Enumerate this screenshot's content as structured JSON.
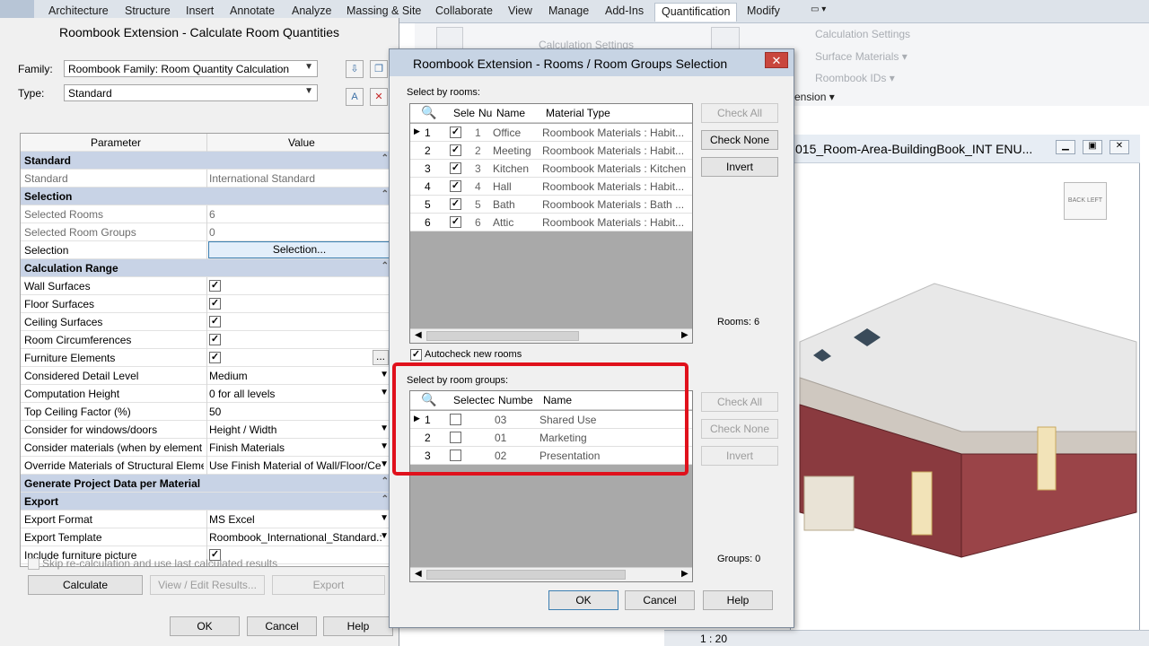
{
  "ribbon": {
    "tabs": [
      "Architecture",
      "Structure",
      "Insert",
      "Annotate",
      "Analyze",
      "Massing & Site",
      "Collaborate",
      "View",
      "Manage",
      "Add-Ins",
      "Quantification",
      "Modify"
    ],
    "active_tab": "Quantification",
    "panel_items": [
      "Calculation Settings",
      "Surface Materials ▾",
      "Roombook IDs ▾"
    ],
    "panel_left_item": "Calculation Settings",
    "panel_label": "ension ▾"
  },
  "viewport": {
    "title": "015_Room-Area-BuildingBook_INT ENU...",
    "viewcube_faces": [
      "BACK",
      "LEFT"
    ],
    "scale": "1 : 20"
  },
  "left_dialog": {
    "title": "Roombook Extension - Calculate Room Quantities",
    "family_label": "Family:",
    "family_value": "Roombook Family: Room Quantity Calculation",
    "type_label": "Type:",
    "type_value": "Standard",
    "grid_headers": [
      "Parameter",
      "Value"
    ],
    "rows": [
      {
        "kind": "cat",
        "label": "Standard"
      },
      {
        "kind": "text",
        "label": "Standard",
        "value": "International Standard",
        "dim": true
      },
      {
        "kind": "cat",
        "label": "Selection"
      },
      {
        "kind": "text",
        "label": "Selected Rooms",
        "value": "6",
        "dim": true
      },
      {
        "kind": "text",
        "label": "Selected Room Groups",
        "value": "0",
        "dim": true
      },
      {
        "kind": "button",
        "label": "Selection",
        "value": "Selection..."
      },
      {
        "kind": "cat",
        "label": "Calculation Range"
      },
      {
        "kind": "check",
        "label": "Wall Surfaces",
        "checked": true
      },
      {
        "kind": "check",
        "label": "Floor Surfaces",
        "checked": true
      },
      {
        "kind": "check",
        "label": "Ceiling Surfaces",
        "checked": true
      },
      {
        "kind": "check",
        "label": "Room Circumferences",
        "checked": true
      },
      {
        "kind": "check",
        "label": "Furniture Elements",
        "checked": true,
        "ellipsis": "..."
      },
      {
        "kind": "dropdown",
        "label": "Considered Detail Level",
        "value": "Medium"
      },
      {
        "kind": "dropdown",
        "label": "Computation Height",
        "value": "0 for all levels"
      },
      {
        "kind": "text",
        "label": "Top Ceiling Factor (%)",
        "value": "50"
      },
      {
        "kind": "dropdown",
        "label": "Consider for windows/doors",
        "value": "Height / Width"
      },
      {
        "kind": "dropdown",
        "label": "Consider materials (when by element i",
        "value": "Finish Materials"
      },
      {
        "kind": "dropdown",
        "label": "Override Materials of Structural Elemer",
        "value": "Use Finish Material of Wall/Floor/Ce"
      },
      {
        "kind": "cat",
        "label": "Generate Project Data per Material"
      },
      {
        "kind": "cat",
        "label": "Export"
      },
      {
        "kind": "dropdown",
        "label": "Export Format",
        "value": "MS Excel"
      },
      {
        "kind": "dropdown",
        "label": "Export Template",
        "value": "Roombook_International_Standard.:"
      },
      {
        "kind": "check",
        "label": "Include furniture picture",
        "checked": true
      }
    ],
    "skip_label": "Skip re-calculation and use last calculated results",
    "calculate": "Calculate",
    "view_edit": "View / Edit Results...",
    "export": "Export",
    "ok": "OK",
    "cancel": "Cancel",
    "help": "Help"
  },
  "selection_dialog": {
    "title": "Roombook Extension - Rooms / Room Groups Selection",
    "close": "✕",
    "rooms_label": "Select by rooms:",
    "rooms_headers": [
      "Sele",
      "Nu",
      "Name",
      "Material Type"
    ],
    "rooms": [
      {
        "idx": "1",
        "num": "1",
        "name": "Office",
        "material": "Roombook Materials : Habit..."
      },
      {
        "idx": "2",
        "num": "2",
        "name": "Meeting",
        "material": "Roombook Materials : Habit..."
      },
      {
        "idx": "3",
        "num": "3",
        "name": "Kitchen",
        "material": "Roombook Materials : Kitchen"
      },
      {
        "idx": "4",
        "num": "4",
        "name": "Hall",
        "material": "Roombook Materials : Habit..."
      },
      {
        "idx": "5",
        "num": "5",
        "name": "Bath",
        "material": "Roombook Materials : Bath ..."
      },
      {
        "idx": "6",
        "num": "6",
        "name": "Attic",
        "material": "Roombook Materials : Habit..."
      }
    ],
    "check_all": "Check All",
    "check_none": "Check None",
    "invert": "Invert",
    "rooms_count": "Rooms: 6",
    "autocheck": "Autocheck new rooms",
    "groups_label": "Select by room groups:",
    "groups_headers": [
      "Selectec",
      "Numbe",
      "Name"
    ],
    "groups": [
      {
        "idx": "1",
        "num": "03",
        "name": "Shared Use"
      },
      {
        "idx": "2",
        "num": "01",
        "name": "Marketing"
      },
      {
        "idx": "3",
        "num": "02",
        "name": "Presentation"
      }
    ],
    "groups_count": "Groups: 0",
    "ok": "OK",
    "cancel": "Cancel",
    "help": "Help"
  },
  "colors": {
    "highlight_red": "#e0111c",
    "category_blue": "#c8d3e6",
    "wall_red": "#8a3a3f"
  }
}
